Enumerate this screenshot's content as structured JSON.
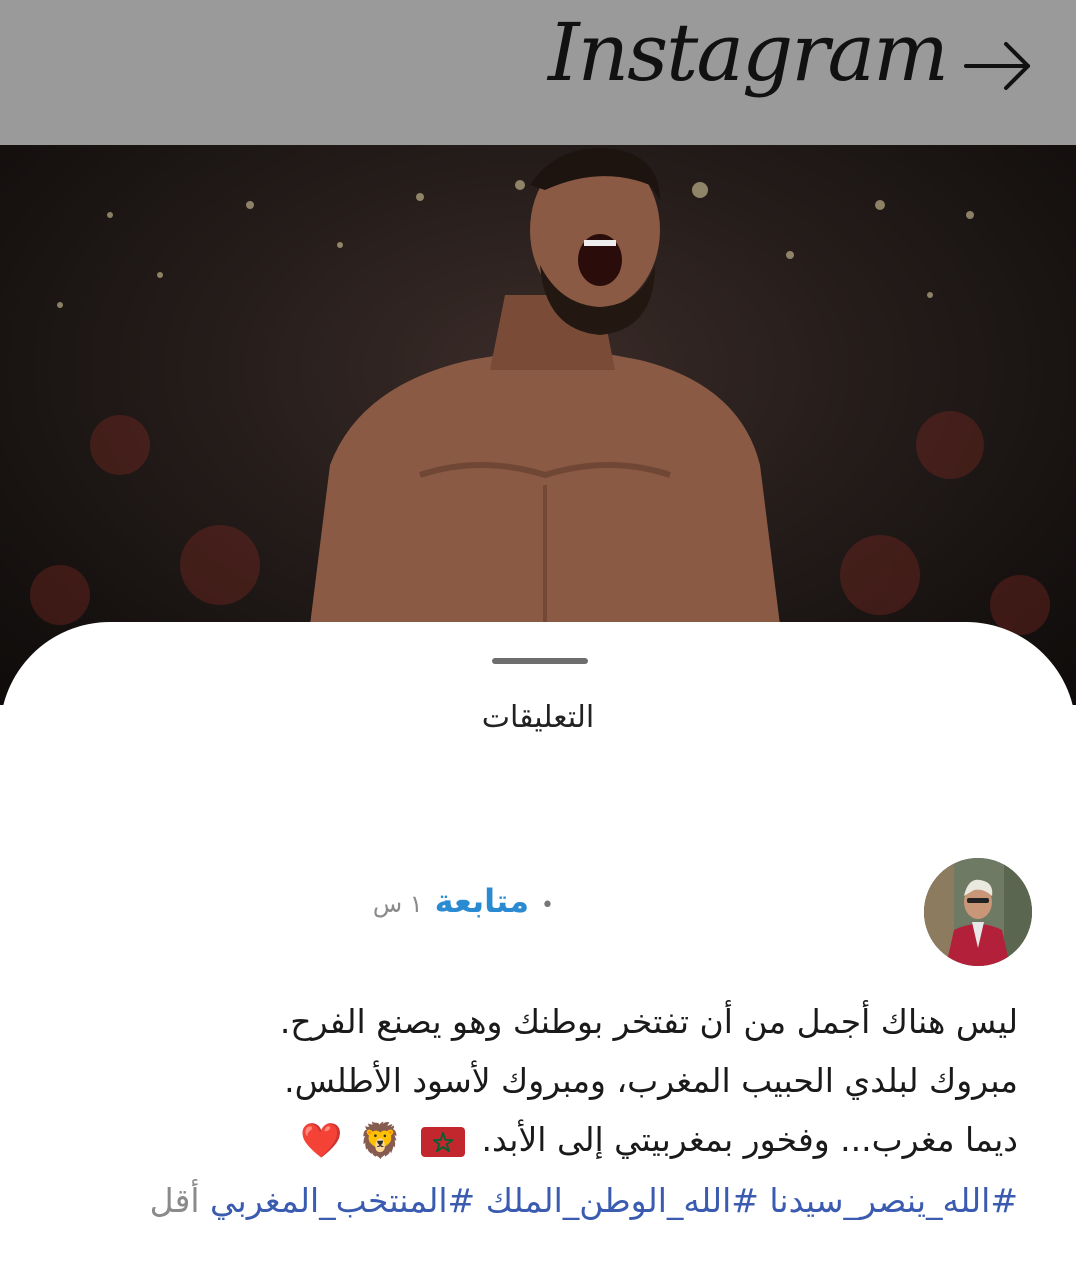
{
  "header": {
    "app_name": "Instagram",
    "back_icon": "arrow-right-icon"
  },
  "photo": {
    "description_icon": "post-photo"
  },
  "sheet": {
    "title": "التعليقات"
  },
  "comment": {
    "follow_label": "متابعة",
    "dot": "•",
    "time": "١ س",
    "lines": [
      "ليس هناك أجمل من أن تفتخر بوطنك وهو يصنع الفرح.",
      "مبروك لبلدي الحبيب المغرب، ومبروك لأسود الأطلس.",
      "ديما مغرب... وفخور بمغربيتي إلى الأبد."
    ],
    "emojis": [
      "🦁",
      "❤️"
    ],
    "hashtags": "#الله_ينصر_سيدنا #الله_الوطن_الملك #المنتخب_المغربي",
    "less_label": "أقل"
  },
  "colors": {
    "header_bg": "#9a9a9a",
    "follow": "#2a8bd3",
    "hashtag": "#3a5bb0",
    "flag_red": "#c1272d",
    "flag_star": "#006233"
  }
}
